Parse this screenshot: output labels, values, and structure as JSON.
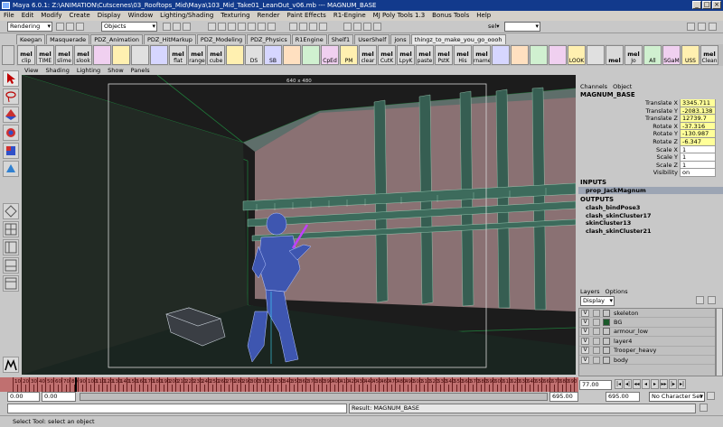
{
  "window": {
    "title": "Maya 6.0.1: Z:\\ANIMATION\\Cutscenes\\03_Rooftops_Mid\\Maya\\103_Mid_Take01_LeanOut_v06.mb  ---  MAGNUM_BASE"
  },
  "menubar": [
    "File",
    "Edit",
    "Modify",
    "Create",
    "Display",
    "Window",
    "Lighting/Shading",
    "Texturing",
    "Render",
    "Paint Effects",
    "R1-Engine",
    "MJ Poly Tools 1.3",
    "Bonus Tools",
    "Help"
  ],
  "statusline": {
    "mode": "Rendering",
    "selection_mask": "Objects",
    "quick_select": "sel▾"
  },
  "shelf_tabs": [
    "Keegan",
    "Masquerade",
    "PDZ_Animation",
    "PDZ_HitMarkup",
    "PDZ_Modeling",
    "PDZ_Physics",
    "R1Engine",
    "Shelf1",
    "UserShelf",
    "jons",
    "thingz_to_make_you_go_oooh"
  ],
  "active_shelf_tab": "thingz_to_make_you_go_oooh",
  "shelf_buttons": [
    {
      "top": "mel",
      "bottom": "clip"
    },
    {
      "top": "mel",
      "bottom": "TIME"
    },
    {
      "top": "mel",
      "bottom": "slime"
    },
    {
      "top": "mel",
      "bottom": "slook"
    },
    {
      "top": "",
      "bottom": ""
    },
    {
      "top": "",
      "bottom": ""
    },
    {
      "top": "",
      "bottom": ""
    },
    {
      "top": "",
      "bottom": ""
    },
    {
      "top": "mel",
      "bottom": "flat"
    },
    {
      "top": "mel",
      "bottom": "range"
    },
    {
      "top": "mel",
      "bottom": "cube"
    },
    {
      "top": "",
      "bottom": ""
    },
    {
      "top": "",
      "bottom": "DS"
    },
    {
      "top": "",
      "bottom": "SB"
    },
    {
      "top": "",
      "bottom": ""
    },
    {
      "top": "",
      "bottom": ""
    },
    {
      "top": "",
      "bottom": "CpEd"
    },
    {
      "top": "",
      "bottom": "PM"
    },
    {
      "top": "mel",
      "bottom": "clear"
    },
    {
      "top": "mel",
      "bottom": "CutK"
    },
    {
      "top": "mel",
      "bottom": "LpyK"
    },
    {
      "top": "mel",
      "bottom": "paste"
    },
    {
      "top": "mel",
      "bottom": "PstK"
    },
    {
      "top": "mel",
      "bottom": "His"
    },
    {
      "top": "mel",
      "bottom": "rname"
    },
    {
      "top": "",
      "bottom": ""
    },
    {
      "top": "",
      "bottom": ""
    },
    {
      "top": "",
      "bottom": ""
    },
    {
      "top": "",
      "bottom": ""
    },
    {
      "top": "",
      "bottom": "LOOK"
    },
    {
      "top": "",
      "bottom": ""
    },
    {
      "top": "mel",
      "bottom": ""
    },
    {
      "top": "mel",
      "bottom": "Jo"
    },
    {
      "top": "",
      "bottom": "All"
    },
    {
      "top": "",
      "bottom": "SGaM"
    },
    {
      "top": "",
      "bottom": "USS"
    },
    {
      "top": "mel",
      "bottom": "Clean"
    }
  ],
  "viewport": {
    "menus": [
      "View",
      "Shading",
      "Lighting",
      "Show",
      "Panels"
    ],
    "resolution_gate_label": "640 x 480"
  },
  "channel_box": {
    "tabs": [
      "Channels",
      "Object"
    ],
    "object": "MAGNUM_BASE",
    "attributes": [
      {
        "name": "Translate X",
        "value": "3345.711",
        "keyed": true
      },
      {
        "name": "Translate Y",
        "value": "-2083.138",
        "keyed": true
      },
      {
        "name": "Translate Z",
        "value": "12739.7",
        "keyed": true
      },
      {
        "name": "Rotate X",
        "value": "-37.316",
        "keyed": true
      },
      {
        "name": "Rotate Y",
        "value": "-130.987",
        "keyed": true
      },
      {
        "name": "Rotate Z",
        "value": "-6.347",
        "keyed": true
      },
      {
        "name": "Scale X",
        "value": "1",
        "keyed": false
      },
      {
        "name": "Scale Y",
        "value": "1",
        "keyed": false
      },
      {
        "name": "Scale Z",
        "value": "1",
        "keyed": false
      },
      {
        "name": "Visibility",
        "value": "on",
        "keyed": false
      }
    ],
    "inputs_label": "INPUTS",
    "inputs": [
      "prop_JackMagnum"
    ],
    "outputs_label": "OUTPUTS",
    "outputs": [
      "clash_bindPose3",
      "clash_skinCluster17",
      "skinCluster13",
      "clash_skinCluster21"
    ]
  },
  "layers": {
    "tabs": [
      "Layers",
      "Options"
    ],
    "display_mode": "Display",
    "items": [
      {
        "v": "V",
        "name": "skeleton",
        "color": ""
      },
      {
        "v": "V",
        "name": "BG",
        "color": "#1a5a2a"
      },
      {
        "v": "V",
        "name": "armour_low",
        "color": ""
      },
      {
        "v": "V",
        "name": "layer4",
        "color": ""
      },
      {
        "v": "V",
        "name": "Trooper_heavy",
        "color": ""
      },
      {
        "v": "V",
        "name": "body",
        "color": ""
      }
    ]
  },
  "timeslider": {
    "labels": [
      "10",
      "20",
      "30",
      "40",
      "50",
      "60",
      "70",
      "80",
      "90",
      "100",
      "110",
      "120",
      "130",
      "140",
      "150",
      "160",
      "170",
      "180",
      "190",
      "200",
      "210",
      "220",
      "230",
      "240",
      "250",
      "260",
      "270",
      "280",
      "290",
      "300",
      "310",
      "320",
      "330",
      "340",
      "350",
      "360",
      "370",
      "380",
      "390",
      "400",
      "410",
      "420",
      "430",
      "440",
      "450",
      "460",
      "470",
      "480",
      "490",
      "500",
      "510",
      "520",
      "530",
      "540",
      "550",
      "560",
      "570",
      "580",
      "590",
      "600",
      "610",
      "620",
      "630",
      "640",
      "650",
      "660",
      "670",
      "680",
      "690"
    ],
    "current_frame": "77.00"
  },
  "range": {
    "start": "0.00",
    "playback_start": "0.00",
    "playback_end": "695.00",
    "end": "695.00",
    "character_set": "No Character Set"
  },
  "command_line": {
    "result": "Result: MAGNUM_BASE"
  },
  "help_line": "Select Tool: select an object"
}
